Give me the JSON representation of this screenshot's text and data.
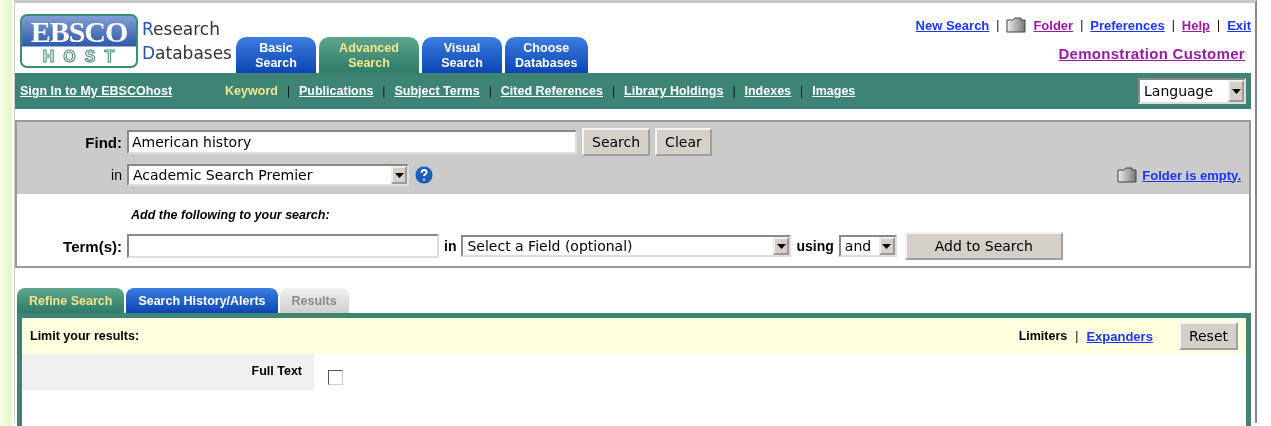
{
  "logo": {
    "top": "EBSCO",
    "bottom": "HOST",
    "lines": [
      {
        "initial": "R",
        "rest": "esearch"
      },
      {
        "initial": "D",
        "rest": "atabases"
      }
    ]
  },
  "main_tabs": [
    {
      "label": "Basic\nSearch",
      "selected": false
    },
    {
      "label": "Advanced\nSearch",
      "selected": true
    },
    {
      "label": "Visual\nSearch",
      "selected": false
    },
    {
      "label": "Choose\nDatabases",
      "selected": false
    }
  ],
  "top_separator": "|",
  "top_links": [
    {
      "label": "New Search",
      "visited": false,
      "icon": false
    },
    {
      "label": "Folder",
      "visited": true,
      "icon": true
    },
    {
      "label": "Preferences",
      "visited": false,
      "icon": false
    },
    {
      "label": "Help",
      "visited": true,
      "icon": false
    },
    {
      "label": "Exit",
      "visited": false,
      "icon": false
    }
  ],
  "customer": {
    "label": "Demonstration Customer",
    "visited": true
  },
  "nav": {
    "sign_in": "Sign In to My EBSCOhost",
    "separator": "|",
    "items": [
      {
        "label": "Keyword",
        "selected": true
      },
      {
        "label": "Publications",
        "selected": false
      },
      {
        "label": "Subject Terms",
        "selected": false
      },
      {
        "label": "Cited References",
        "selected": false
      },
      {
        "label": "Library Holdings",
        "selected": false
      },
      {
        "label": "Indexes",
        "selected": false
      },
      {
        "label": "Images",
        "selected": false
      }
    ],
    "language": "Language"
  },
  "search": {
    "find_label": "Find:",
    "find_value": "American history",
    "search_button": "Search",
    "clear_button": "Clear",
    "in_label": "in",
    "database": "Academic Search Premier",
    "folder_status": "Folder is empty.",
    "add_heading": "Add the following to your search:",
    "terms_label": "Term(s):",
    "terms_in": "in",
    "field": "Select a Field (optional)",
    "using_label": "using",
    "operator": "and",
    "add_button": "Add to Search"
  },
  "lower_tabs": [
    {
      "label": "Refine Search",
      "selected": true,
      "disabled": false
    },
    {
      "label": "Search History/Alerts",
      "selected": false,
      "disabled": false
    },
    {
      "label": "Results",
      "selected": false,
      "disabled": true
    }
  ],
  "limits": {
    "heading": "Limit your results:",
    "limiters": "Limiters",
    "separator": "|",
    "expanders": "Expanders",
    "reset": "Reset",
    "rows": [
      {
        "label": "Full Text",
        "checked": false
      }
    ]
  }
}
